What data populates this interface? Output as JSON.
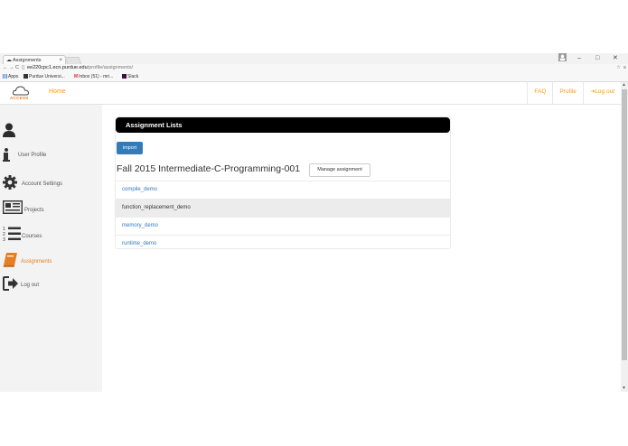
{
  "browser": {
    "tab_title": "Assignments",
    "tab_close": "×",
    "window_controls": [
      "–",
      "□",
      "✕"
    ],
    "url_host": "ee220cpc1.ecn.purdue.edu",
    "url_path": "/profile/assignments/",
    "bookmarks": [
      "Apps",
      "Purdue Universi...",
      "Inbox (51) - mri...",
      "Slack"
    ]
  },
  "header": {
    "logo_text": "ACCESS",
    "home_label": "Home",
    "nav": [
      "FAQ",
      "Profile",
      "Log out"
    ]
  },
  "sidebar": {
    "items": [
      {
        "label": "",
        "icon": "user-icon"
      },
      {
        "label": "User Profile",
        "icon": "info-icon"
      },
      {
        "label": "Account Settings",
        "icon": "gear-icon"
      },
      {
        "label": "Projects",
        "icon": "newspaper-icon"
      },
      {
        "label": "Courses",
        "icon": "list-ordered-icon"
      },
      {
        "label": "Assignments",
        "icon": "book-icon"
      },
      {
        "label": "Log out",
        "icon": "sign-out-icon"
      }
    ]
  },
  "main": {
    "panel_title": "Assignment Lists",
    "import_label": "import",
    "course_title": "Fall 2015 Intermediate-C-Programming-001",
    "manage_label": "Manage assignment",
    "assignments": [
      "compile_demo",
      "function_replacement_demo",
      "memory_demo",
      "runtime_demo"
    ]
  },
  "colors": {
    "accent": "#f39c12",
    "primary_button": "#337ab7",
    "panel_header": "#000000"
  }
}
